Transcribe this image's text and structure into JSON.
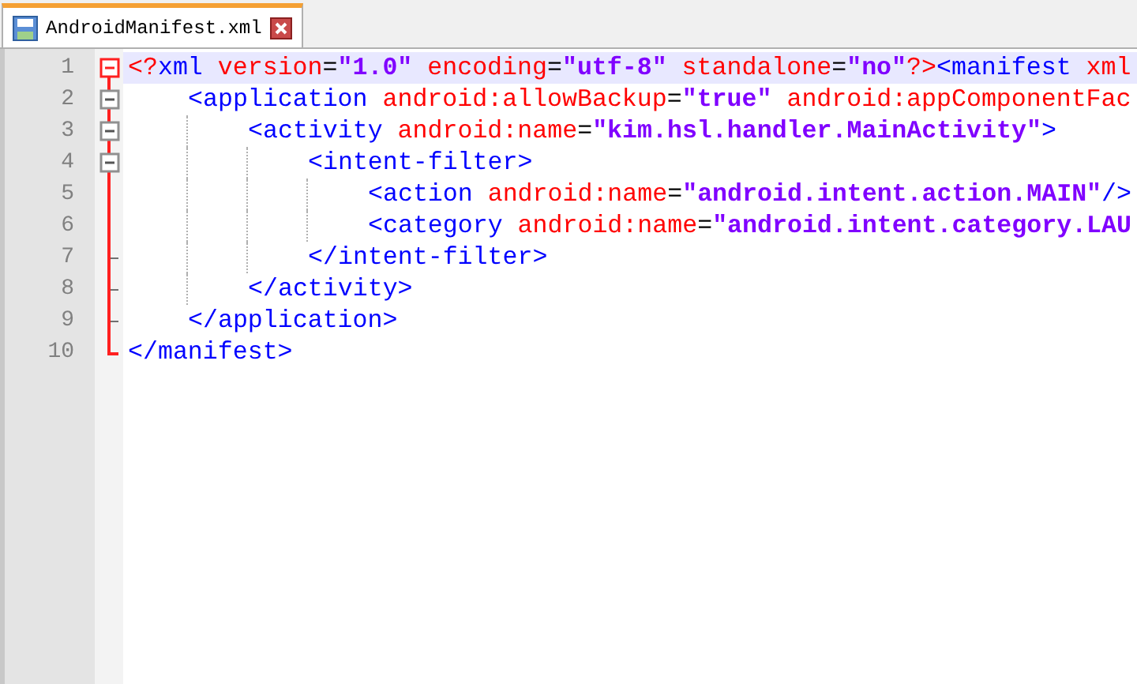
{
  "tab": {
    "label": "AndroidManifest.xml",
    "selected": true
  },
  "lines": [
    {
      "number": "1",
      "current": true,
      "expanded": true,
      "tokens": [
        {
          "kind": "decl",
          "text": "<?"
        },
        {
          "kind": "tag",
          "text": "xml"
        },
        {
          "kind": "attr",
          "text": " version"
        },
        {
          "kind": "eq",
          "text": "="
        },
        {
          "kind": "value",
          "text": "\"1.0\""
        },
        {
          "kind": "attr",
          "text": " encoding"
        },
        {
          "kind": "eq",
          "text": "="
        },
        {
          "kind": "value",
          "text": "\"utf-8\""
        },
        {
          "kind": "attr",
          "text": " standalone"
        },
        {
          "kind": "eq",
          "text": "="
        },
        {
          "kind": "value",
          "text": "\"no\""
        },
        {
          "kind": "decl",
          "text": "?>"
        },
        {
          "kind": "tag",
          "text": "<manifest"
        },
        {
          "kind": "attr",
          "text": " xml"
        }
      ],
      "closing": {
        "number": "10",
        "tokens": [
          {
            "kind": "tag",
            "text": "</manifest>"
          }
        ]
      },
      "children": [
        {
          "number": "2",
          "current": false,
          "expanded": true,
          "tokens": [
            {
              "kind": "tag",
              "text": "<application"
            },
            {
              "kind": "attr",
              "text": " android:allowBackup"
            },
            {
              "kind": "eq",
              "text": "="
            },
            {
              "kind": "value",
              "text": "\"true\""
            },
            {
              "kind": "attr",
              "text": " android:appComponentFac"
            }
          ],
          "closing": {
            "number": "9",
            "tokens": [
              {
                "kind": "tag",
                "text": "</application>"
              }
            ]
          },
          "children": [
            {
              "number": "3",
              "current": false,
              "expanded": true,
              "tokens": [
                {
                  "kind": "tag",
                  "text": "<activity"
                },
                {
                  "kind": "attr",
                  "text": " android:name"
                },
                {
                  "kind": "eq",
                  "text": "="
                },
                {
                  "kind": "value",
                  "text": "\"kim.hsl.handler.MainActivity\""
                },
                {
                  "kind": "tag",
                  "text": ">"
                }
              ],
              "closing": {
                "number": "8",
                "tokens": [
                  {
                    "kind": "tag",
                    "text": "</activity>"
                  }
                ]
              },
              "children": [
                {
                  "number": "4",
                  "current": false,
                  "expanded": true,
                  "tokens": [
                    {
                      "kind": "tag",
                      "text": "<intent-filter>"
                    }
                  ],
                  "closing": {
                    "number": "7",
                    "tokens": [
                      {
                        "kind": "tag",
                        "text": "</intent-filter>"
                      }
                    ]
                  },
                  "children": [
                    {
                      "number": "5",
                      "current": false,
                      "tokens": [
                        {
                          "kind": "tag",
                          "text": "<action"
                        },
                        {
                          "kind": "attr",
                          "text": " android:name"
                        },
                        {
                          "kind": "eq",
                          "text": "="
                        },
                        {
                          "kind": "value",
                          "text": "\"android.intent.action.MAIN\""
                        },
                        {
                          "kind": "tag",
                          "text": "/>"
                        }
                      ]
                    },
                    {
                      "number": "6",
                      "current": false,
                      "tokens": [
                        {
                          "kind": "tag",
                          "text": "<category"
                        },
                        {
                          "kind": "attr",
                          "text": " android:name"
                        },
                        {
                          "kind": "eq",
                          "text": "="
                        },
                        {
                          "kind": "value",
                          "text": "\"android.intent.category.LAU"
                        }
                      ]
                    }
                  ]
                }
              ]
            }
          ]
        }
      ]
    }
  ]
}
